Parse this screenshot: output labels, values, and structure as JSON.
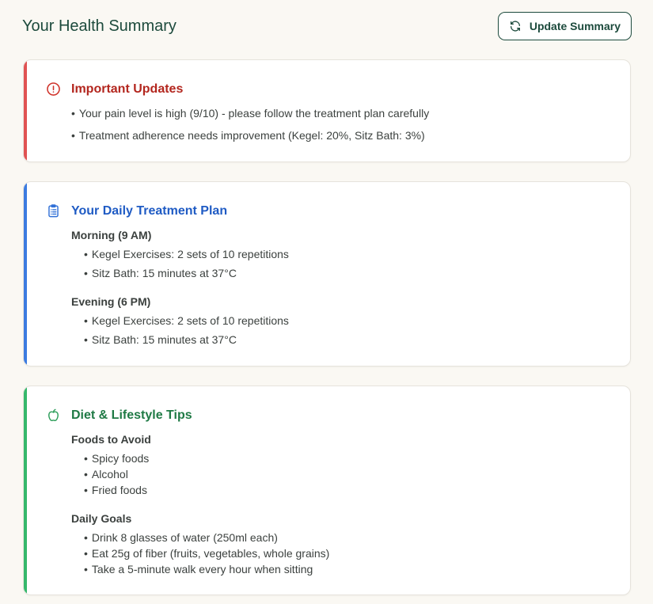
{
  "header": {
    "title": "Your Health Summary",
    "update_button": "Update Summary"
  },
  "colors": {
    "alert": "#c0392b",
    "plan": "#2f6fd6",
    "diet": "#2e9e5b",
    "brand": "#1c4a3c"
  },
  "updates": {
    "title": "Important Updates",
    "icon": "alert-circle-icon",
    "items": [
      "Your pain level is high (9/10) - please follow the treatment plan carefully",
      "Treatment adherence needs improvement (Kegel: 20%, Sitz Bath: 3%)"
    ]
  },
  "plan": {
    "title": "Your Daily Treatment Plan",
    "icon": "clipboard-list-icon",
    "morning": {
      "label": "Morning (9 AM)",
      "items": [
        "Kegel Exercises: 2 sets of 10 repetitions",
        "Sitz Bath: 15 minutes at 37°C"
      ]
    },
    "evening": {
      "label": "Evening (6 PM)",
      "items": [
        "Kegel Exercises: 2 sets of 10 repetitions",
        "Sitz Bath: 15 minutes at 37°C"
      ]
    }
  },
  "diet": {
    "title": "Diet & Lifestyle Tips",
    "icon": "apple-icon",
    "avoid": {
      "label": "Foods to Avoid",
      "items": [
        "Spicy foods",
        "Alcohol",
        "Fried foods"
      ]
    },
    "goals": {
      "label": "Daily Goals",
      "items": [
        "Drink 8 glasses of water (250ml each)",
        "Eat 25g of fiber (fruits, vegetables, whole grains)",
        "Take a 5-minute walk every hour when sitting"
      ]
    }
  }
}
